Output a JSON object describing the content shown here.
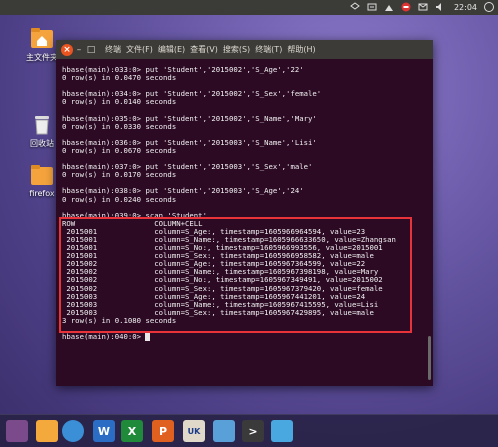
{
  "panel": {
    "clock": "22:04"
  },
  "desktop": {
    "icons": [
      {
        "label": "主文件夹",
        "icon": "home-folder-icon"
      },
      {
        "label": "回收站",
        "icon": "trash-icon"
      },
      {
        "label": "firefox",
        "icon": "firefox-icon"
      }
    ]
  },
  "terminal": {
    "menu": [
      "终端",
      "文件(F)",
      "编辑(E)",
      "查看(V)",
      "搜索(S)",
      "终端(T)",
      "帮助(H)"
    ],
    "lines": [
      "hbase(main):033:0> put 'Student','2015002','S_Age','22'",
      "0 row(s) in 0.0470 seconds",
      "",
      "hbase(main):034:0> put 'Student','2015002','S_Sex','female'",
      "0 row(s) in 0.0140 seconds",
      "",
      "hbase(main):035:0> put 'Student','2015002','S_Name','Mary'",
      "0 row(s) in 0.0330 seconds",
      "",
      "hbase(main):036:0> put 'Student','2015003','S_Name','Lisi'",
      "0 row(s) in 0.0670 seconds",
      "",
      "hbase(main):037:0> put 'Student','2015003','S_Sex','male'",
      "0 row(s) in 0.0170 seconds",
      "",
      "hbase(main):038:0> put 'Student','2015003','S_Age','24'",
      "0 row(s) in 0.0240 seconds",
      "",
      "hbase(main):039:0> scan 'Student'",
      "ROW                  COLUMN+CELL",
      " 2015001             column=S_Age:, timestamp=1605966964594, value=23",
      " 2015001             column=S_Name:, timestamp=1605966633650, value=Zhangsan",
      " 2015001             column=S_No:, timestamp=1605966993556, value=2015001",
      " 2015001             column=S_Sex:, timestamp=1605966958582, value=male",
      " 2015002             column=S_Age:, timestamp=1605967364599, value=22",
      " 2015002             column=S_Name:, timestamp=1605967398198, value=Mary",
      " 2015002             column=S_No:, timestamp=1605967349491, value=2015002",
      " 2015002             column=S_Sex:, timestamp=1605967379420, value=female",
      " 2015003             column=S_Age:, timestamp=1605967441201, value=24",
      " 2015003             column=S_Name:, timestamp=1605967415595, value=Lisi",
      " 2015003             column=S_Sex:, timestamp=1605967429895, value=male",
      "3 row(s) in 0.1080 seconds",
      "",
      "hbase(main):040:0> "
    ]
  },
  "dock": {
    "items": [
      {
        "name": "ubuntu-logo-icon",
        "color": "#7a4a8a"
      },
      {
        "name": "files-icon",
        "color": "#f4a93c"
      },
      {
        "name": "chromium-icon",
        "color": "#3a8fd6"
      },
      {
        "name": "writer-icon",
        "color": "#2b6cc4",
        "glyph": "W"
      },
      {
        "name": "calc-icon",
        "color": "#1f8a3a",
        "glyph": "X"
      },
      {
        "name": "impress-icon",
        "color": "#e06020",
        "glyph": "P"
      },
      {
        "name": "uk-bag-icon",
        "color": "#e0d8c8",
        "glyph": "UK"
      },
      {
        "name": "mail-icon",
        "color": "#5aa0d8"
      },
      {
        "name": "terminal-icon",
        "color": "#3a3a3a",
        "glyph": ">"
      },
      {
        "name": "screenshot-icon",
        "color": "#4aa8e0"
      }
    ]
  }
}
